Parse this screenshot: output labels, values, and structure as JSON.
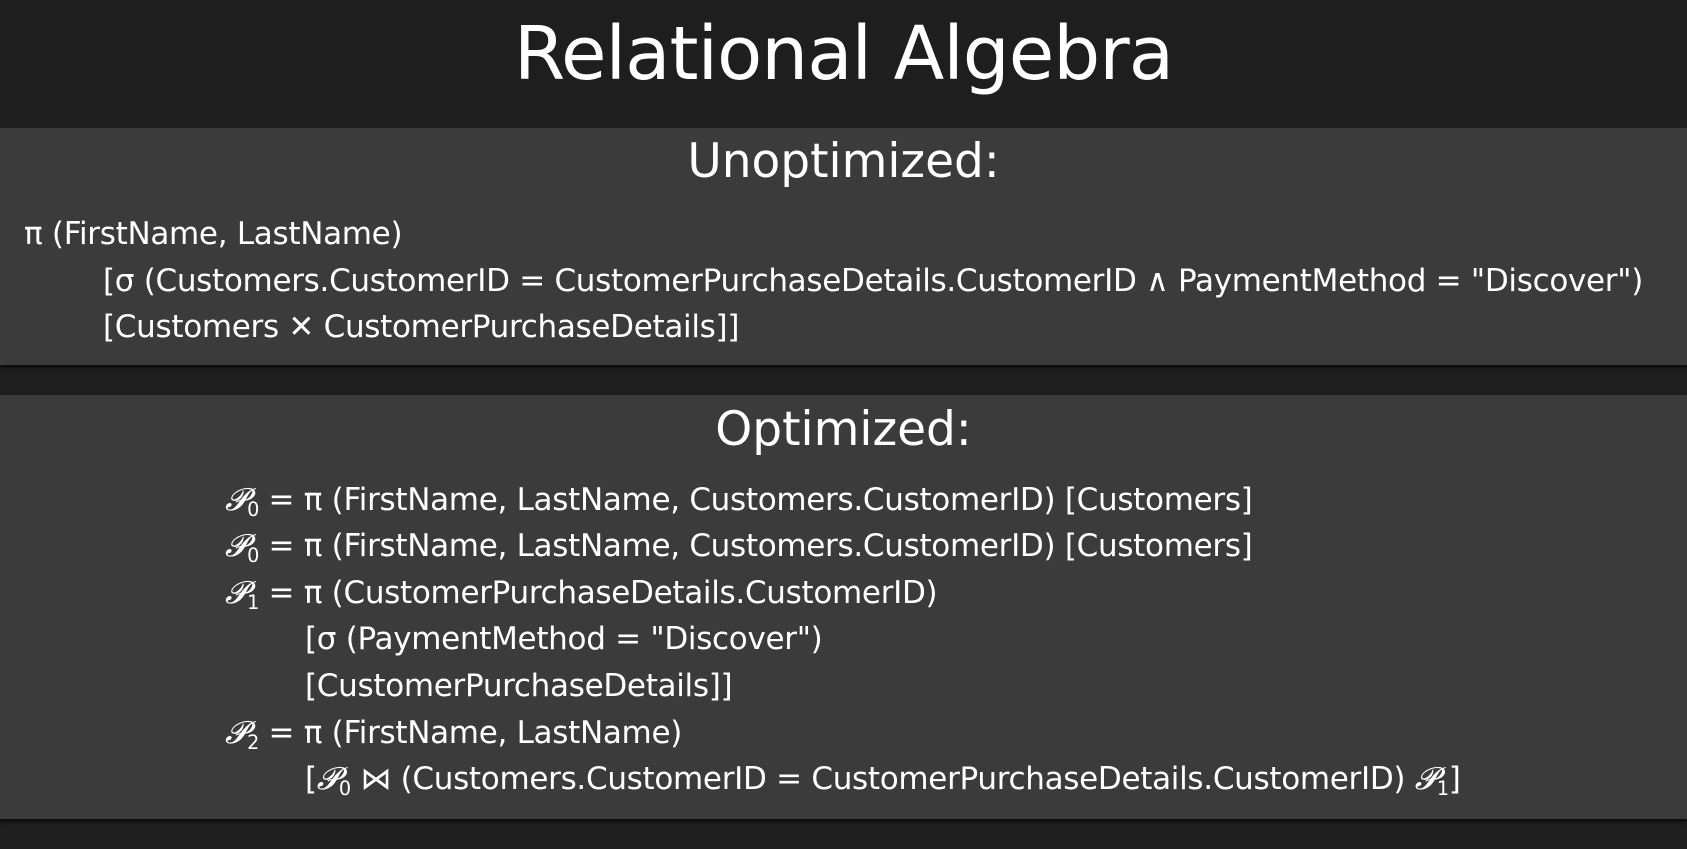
{
  "title": "Relational Algebra",
  "unoptimized": {
    "heading": "Unoptimized:",
    "lines": [
      "π (FirstName, LastName)",
      "[σ (Customers.CustomerID = CustomerPurchaseDetails.CustomerID ∧ PaymentMethod = \"Discover\")",
      "[Customers ✕ CustomerPurchaseDetails]]"
    ]
  },
  "optimized": {
    "heading": "Optimized:",
    "lines": [
      {
        "var": "𝓟",
        "sub": "0",
        "text": " = π (FirstName, LastName, Customers.CustomerID) [Customers]"
      },
      {
        "var": "𝓟",
        "sub": "0",
        "text": " = π (FirstName, LastName, Customers.CustomerID) [Customers]"
      },
      {
        "var": "𝓟",
        "sub": "1",
        "text": " = π (CustomerPurchaseDetails.CustomerID)"
      },
      {
        "text": "[σ (PaymentMethod = \"Discover\")"
      },
      {
        "text": "[CustomerPurchaseDetails]]"
      },
      {
        "var": "𝓟",
        "sub": "2",
        "text": " = π (FirstName, LastName)"
      },
      {
        "pre": "[",
        "var": "𝓟",
        "sub": "0",
        "text": " ⋈ (Customers.CustomerID = CustomerPurchaseDetails.CustomerID) ",
        "var2": "𝓟",
        "sub2": "1",
        "post": "]"
      }
    ]
  }
}
